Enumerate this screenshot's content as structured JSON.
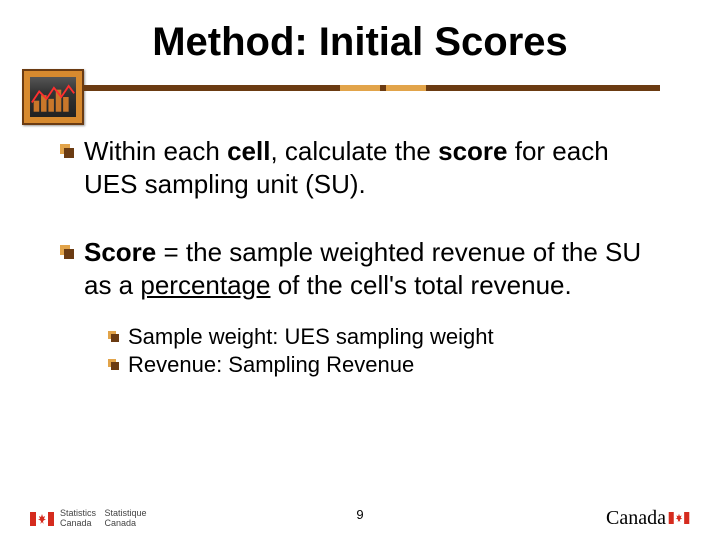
{
  "title": "Method: Initial Scores",
  "bullets": [
    {
      "pre": "Within each ",
      "bold1": "cell",
      "mid": ", calculate the ",
      "bold2": "score",
      "post": " for each UES sampling unit (SU)."
    },
    {
      "bold1": "Score",
      "mid": " = the sample weighted revenue of the SU as a ",
      "underline": "percentage",
      "post": " of the cell's total revenue."
    }
  ],
  "subbullets": [
    "Sample weight: UES sampling weight",
    "Revenue: Sampling Revenue"
  ],
  "page_number": "9",
  "footer": {
    "stat_en_1": "Statistics",
    "stat_en_2": "Canada",
    "stat_fr_1": "Statistique",
    "stat_fr_2": "Canada",
    "wordmark": "Canada"
  }
}
